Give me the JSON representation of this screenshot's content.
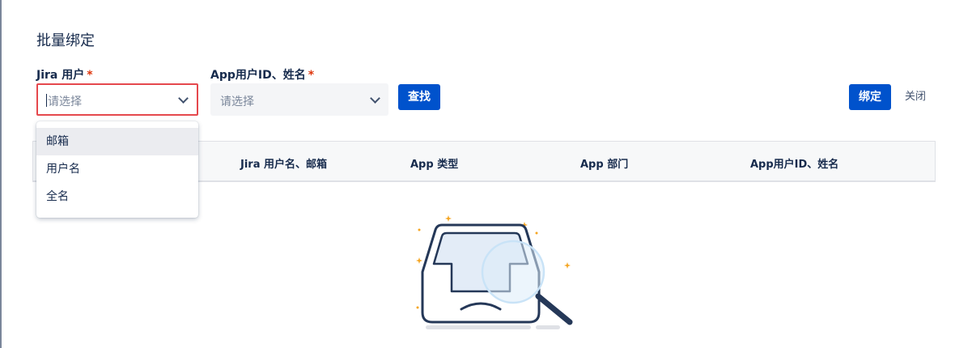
{
  "dialog": {
    "title": "批量绑定"
  },
  "form": {
    "jira_user": {
      "label": "Jira 用户",
      "required_mark": "*",
      "placeholder": "请选择",
      "options": [
        "邮箱",
        "用户名",
        "全名"
      ],
      "highlighted_option_index": 0
    },
    "app_user": {
      "label": "App用户ID、姓名",
      "required_mark": "*",
      "placeholder": "请选择"
    },
    "search_button": "查找"
  },
  "actions": {
    "bind_button": "绑定",
    "close_button": "关闭"
  },
  "table": {
    "columns": [
      "Jira 用户名、邮箱",
      "App 类型",
      "App 部门",
      "App用户ID、姓名"
    ]
  },
  "colors": {
    "primary": "#0052cc",
    "error_border": "#e5484d",
    "required": "#de350b",
    "sparkle": "#f5a623"
  },
  "icons": {
    "dropdown_chevron": "chevron-down-icon",
    "empty_state": "empty-box-magnifier-illustration"
  }
}
